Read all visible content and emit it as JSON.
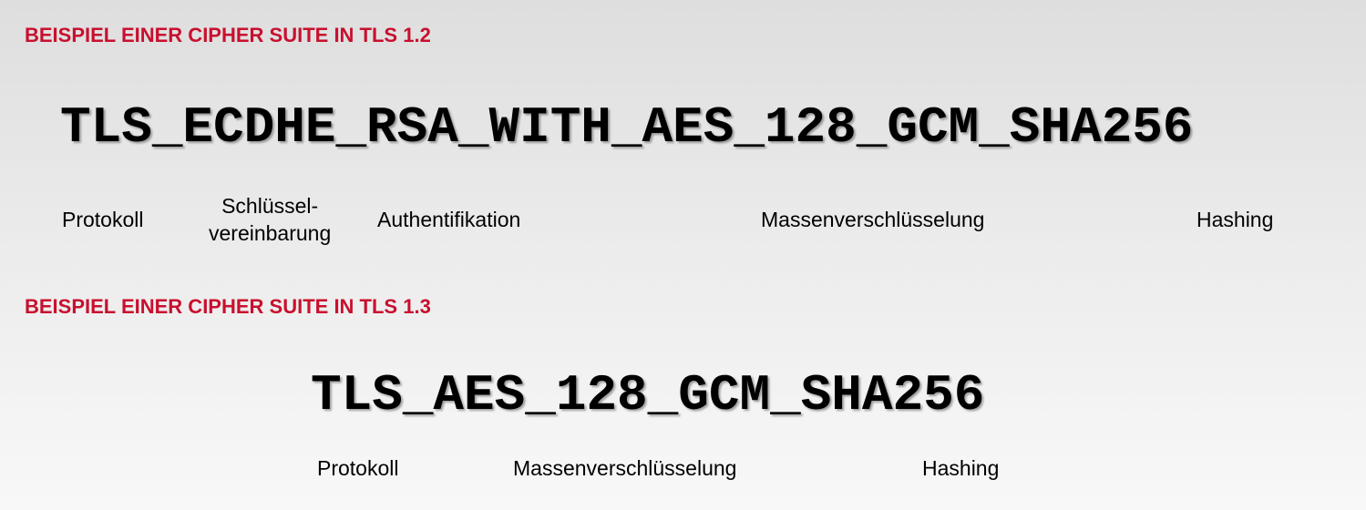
{
  "section_tls12": {
    "heading": "BEISPIEL EINER CIPHER SUITE IN TLS 1.2",
    "suite": "TLS_ECDHE_RSA_WITH_AES_128_GCM_SHA256",
    "labels": {
      "protocol": "Protokoll",
      "key_exchange_line1": "Schlüssel-",
      "key_exchange_line2": "vereinbarung",
      "authentication": "Authentifikation",
      "bulk_encryption": "Massenverschlüsselung",
      "hashing": "Hashing"
    }
  },
  "section_tls13": {
    "heading": "BEISPIEL EINER CIPHER SUITE IN TLS 1.3",
    "suite": "TLS_AES_128_GCM_SHA256",
    "labels": {
      "protocol": "Protokoll",
      "bulk_encryption": "Massenverschlüsselung",
      "hashing": "Hashing"
    }
  },
  "colors": {
    "heading": "#c8102e",
    "suite_text": "#000000"
  }
}
